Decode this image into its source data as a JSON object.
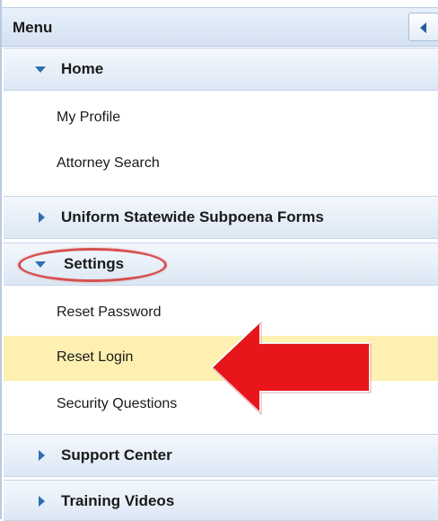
{
  "menu": {
    "title": "Menu",
    "collapse_icon": "triangle-left-icon"
  },
  "sections": {
    "home": {
      "label": "Home",
      "expanded": true,
      "items": [
        "My Profile",
        "Attorney Search"
      ]
    },
    "subpoena": {
      "label": "Uniform Statewide Subpoena Forms",
      "expanded": false
    },
    "settings": {
      "label": "Settings",
      "expanded": true,
      "items": [
        "Reset Password",
        "Reset Login",
        "Security Questions"
      ],
      "selected_item": "Reset Login"
    },
    "support": {
      "label": "Support Center",
      "expanded": false
    },
    "training": {
      "label": "Training Videos",
      "expanded": false
    }
  },
  "annotations": {
    "oval_color": "#d6504f",
    "arrow_color": "#e8151b"
  }
}
